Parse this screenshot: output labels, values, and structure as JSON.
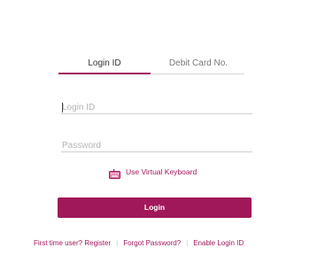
{
  "tabs": {
    "login_id": "Login ID",
    "debit_card": "Debit Card No."
  },
  "form": {
    "login_id_placeholder": "Login ID",
    "password_placeholder": "Password"
  },
  "virtual_keyboard": {
    "label": "Use Virtual Keyboard",
    "icon": "keyboard-icon"
  },
  "login_button": {
    "label": "Login"
  },
  "footer": {
    "register": "First time user? Register",
    "separator": "|",
    "forgot": "Forgot Password?",
    "enable": "Enable Login ID"
  },
  "colors": {
    "accent": "#a1185a",
    "text": "#666666",
    "placeholder": "#b5b5b5",
    "divider": "#cfcfcf"
  }
}
